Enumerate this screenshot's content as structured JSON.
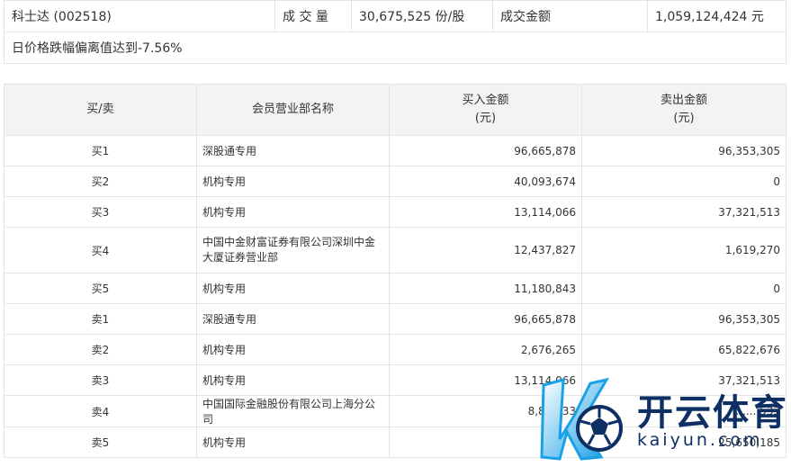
{
  "summary": {
    "stock": "科士达 (002518)",
    "volume_label": "成 交 量",
    "volume_value": "30,675,525 份/股",
    "amount_label": "成交金额",
    "amount_value": "1,059,124,424 元",
    "note": "日价格跌幅偏离值达到-7.56%"
  },
  "table": {
    "headers": [
      "买/卖",
      "会员营业部名称",
      "买入金额",
      "(元)",
      "卖出金额",
      "(元)"
    ],
    "rows": [
      {
        "side": "买1",
        "name": "深股通专用",
        "buy": "96,665,878",
        "sell": "96,353,305"
      },
      {
        "side": "买2",
        "name": "机构专用",
        "buy": "40,093,674",
        "sell": "0"
      },
      {
        "side": "买3",
        "name": "机构专用",
        "buy": "13,114,066",
        "sell": "37,321,513"
      },
      {
        "side": "买4",
        "name": "中国中金财富证券有限公司深圳中金大厦证券营业部",
        "buy": "12,437,827",
        "sell": "1,619,270"
      },
      {
        "side": "买5",
        "name": "机构专用",
        "buy": "11,180,843",
        "sell": "0"
      },
      {
        "side": "卖1",
        "name": "深股通专用",
        "buy": "96,665,878",
        "sell": "96,353,305"
      },
      {
        "side": "卖2",
        "name": "机构专用",
        "buy": "2,676,265",
        "sell": "65,822,676"
      },
      {
        "side": "卖3",
        "name": "机构专用",
        "buy": "13,114,066",
        "sell": "37,321,513"
      },
      {
        "side": "卖4",
        "name": "中国国际金融股份有限公司上海分公司",
        "buy": "8,8..,333",
        "sell": "..,...,533"
      },
      {
        "side": "卖5",
        "name": "机构专用",
        "buy": "",
        "sell": "25,650,185"
      }
    ]
  },
  "watermark": {
    "cn": "开云体育",
    "en": "kaiyun.com",
    "colors": {
      "primary": "#0d2f63",
      "accent": "#1aa0e6"
    }
  }
}
